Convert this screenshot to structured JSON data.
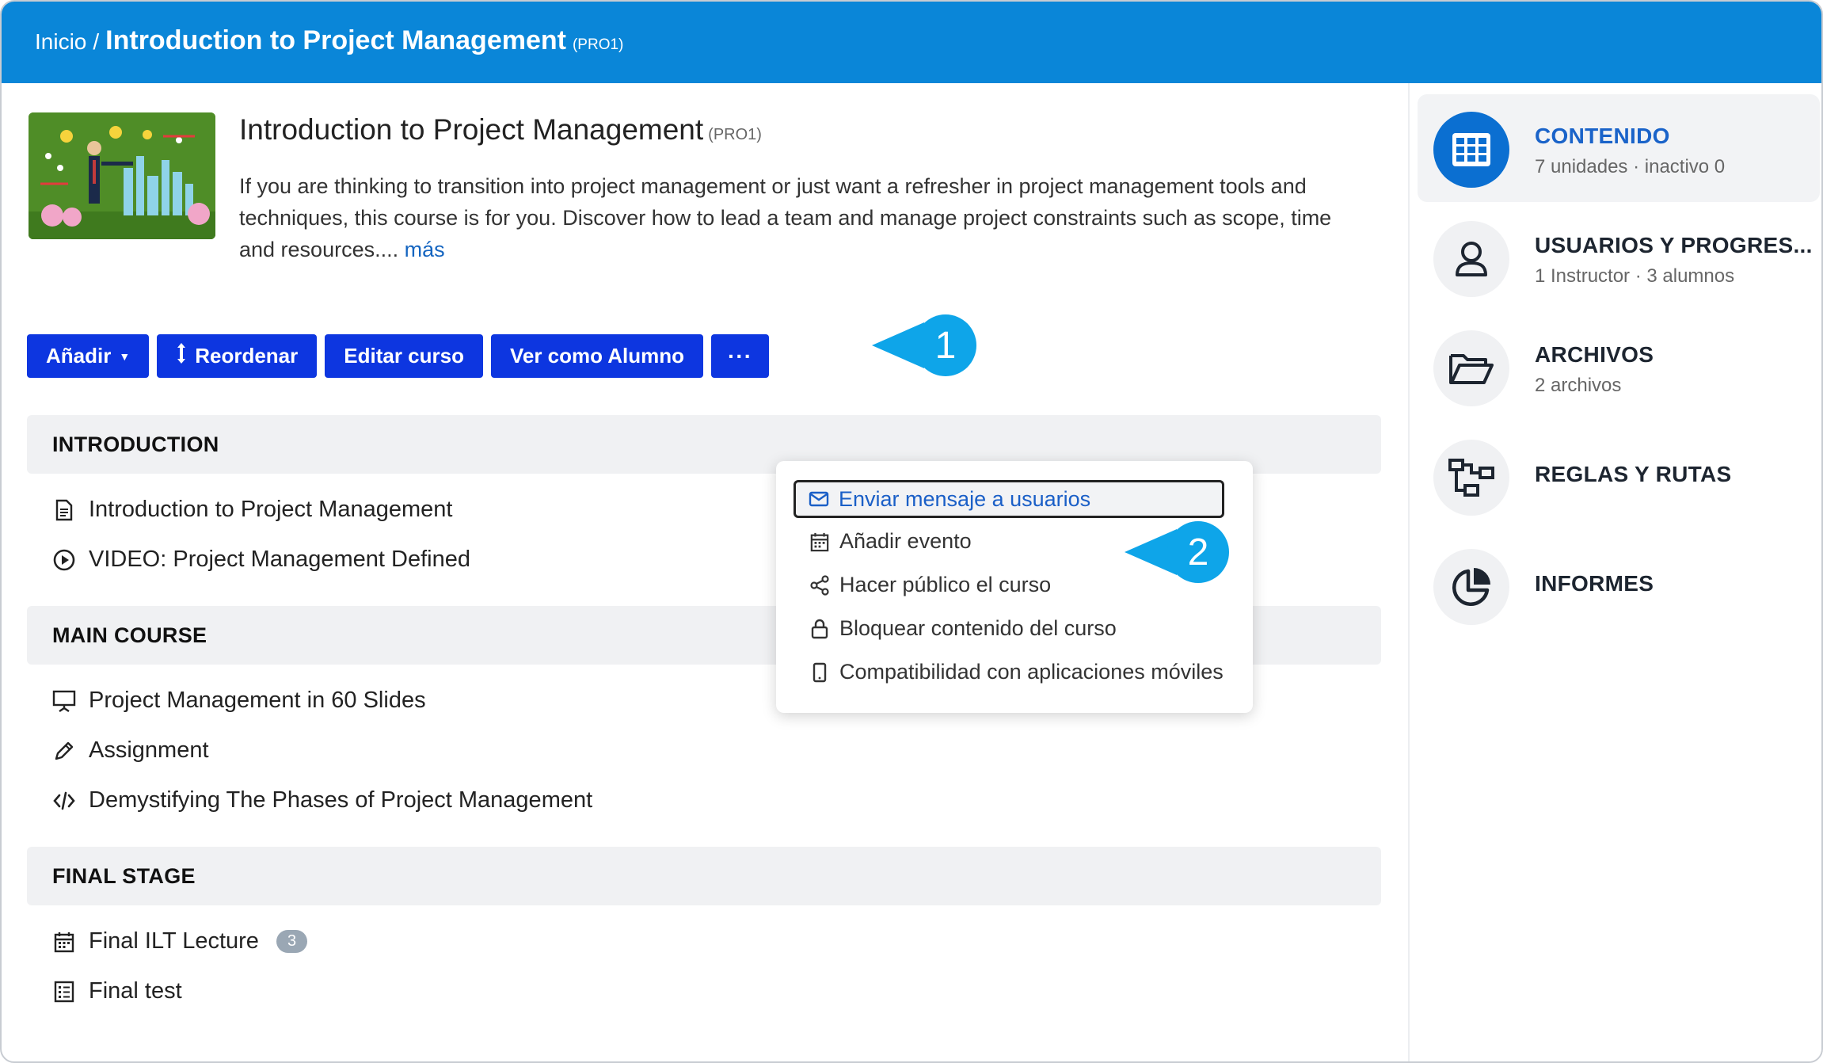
{
  "header": {
    "home": "Inicio",
    "separator": "/",
    "title": "Introduction to Project Management",
    "code": "(PRO1)"
  },
  "course": {
    "title": "Introduction to Project Management",
    "code": "(PRO1)",
    "description": "If you are thinking to transition into project management or just want a refresher in project management tools and techniques, this course is for you. Discover how to lead a team and manage project constraints such as scope, time and resources....",
    "more": "más"
  },
  "toolbar": {
    "add": "Añadir",
    "reorder": "Reordenar",
    "edit": "Editar curso",
    "view_as_student": "Ver como Alumno",
    "more": "···"
  },
  "markers": {
    "one": "1",
    "two": "2"
  },
  "dropdown": {
    "items": [
      {
        "label": "Enviar mensaje a usuarios",
        "icon": "envelope-icon"
      },
      {
        "label": "Añadir evento",
        "icon": "calendar-icon"
      },
      {
        "label": "Hacer público el curso",
        "icon": "share-icon"
      },
      {
        "label": "Bloquear contenido del curso",
        "icon": "lock-icon"
      },
      {
        "label": "Compatibilidad con aplicaciones móviles",
        "icon": "mobile-icon"
      }
    ]
  },
  "sections": [
    {
      "title": "INTRODUCTION",
      "items": [
        {
          "label": "Introduction to Project Management",
          "icon": "document-icon"
        },
        {
          "label": "VIDEO: Project Management Defined",
          "icon": "play-icon"
        }
      ]
    },
    {
      "title": "MAIN COURSE",
      "items": [
        {
          "label": "Project Management in 60 Slides",
          "icon": "presentation-icon"
        },
        {
          "label": "Assignment",
          "icon": "pencil-icon"
        },
        {
          "label": "Demystifying The Phases of Project Management",
          "icon": "code-icon"
        }
      ]
    },
    {
      "title": "FINAL STAGE",
      "items": [
        {
          "label": "Final ILT Lecture",
          "icon": "calendar-icon",
          "badge": "3"
        },
        {
          "label": "Final test",
          "icon": "test-icon"
        }
      ]
    }
  ],
  "sidebar": {
    "items": [
      {
        "title": "CONTENIDO",
        "subtitle": "7 unidades · inactivo 0",
        "icon": "grid-icon"
      },
      {
        "title": "USUARIOS Y PROGRES...",
        "subtitle": "1 Instructor · 3 alumnos",
        "icon": "user-icon"
      },
      {
        "title": "ARCHIVOS",
        "subtitle": "2 archivos",
        "icon": "folder-icon"
      },
      {
        "title": "REGLAS Y RUTAS",
        "icon": "path-icon"
      },
      {
        "title": "INFORMES",
        "icon": "pie-chart-icon"
      }
    ]
  },
  "colors": {
    "header": "#0a86d8",
    "button": "#0d36e0",
    "marker": "#0ea5e9",
    "active_sidebar_icon": "#0b6fd1"
  }
}
